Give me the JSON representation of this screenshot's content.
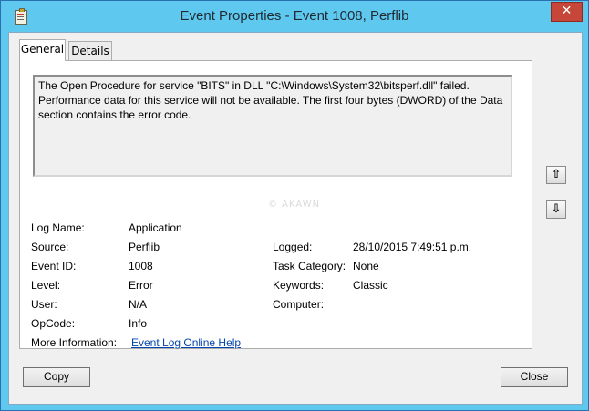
{
  "window": {
    "title": "Event Properties - Event 1008, Perflib",
    "close_glyph": "✕"
  },
  "tabs": [
    {
      "label": "General",
      "active": true
    },
    {
      "label": "Details",
      "active": false
    }
  ],
  "description": "The Open Procedure for service \"BITS\" in DLL \"C:\\Windows\\System32\\bitsperf.dll\" failed. Performance data for this service will not be available. The first four bytes (DWORD) of the Data section contains the error code.",
  "watermark": "© AKAWN",
  "fields": {
    "log_name": {
      "label": "Log Name:",
      "value": "Application"
    },
    "source": {
      "label": "Source:",
      "value": "Perflib"
    },
    "event_id": {
      "label": "Event ID:",
      "value": "1008"
    },
    "level": {
      "label": "Level:",
      "value": "Error"
    },
    "user": {
      "label": "User:",
      "value": "N/A"
    },
    "opcode": {
      "label": "OpCode:",
      "value": "Info"
    },
    "more_info": {
      "label": "More Information:",
      "value": "Event Log Online Help"
    },
    "logged": {
      "label": "Logged:",
      "value": "28/10/2015 7:49:51 p.m."
    },
    "task_category": {
      "label": "Task Category:",
      "value": "None"
    },
    "keywords": {
      "label": "Keywords:",
      "value": "Classic"
    },
    "computer": {
      "label": "Computer:",
      "value": ""
    }
  },
  "nav": {
    "up_glyph": "⇧",
    "down_glyph": "⇩"
  },
  "buttons": {
    "copy": "Copy",
    "close": "Close"
  },
  "colors": {
    "titlebar": "#5ec8ee",
    "client": "#f0f0f0",
    "close_button": "#c7463a",
    "link": "#0645ad"
  }
}
